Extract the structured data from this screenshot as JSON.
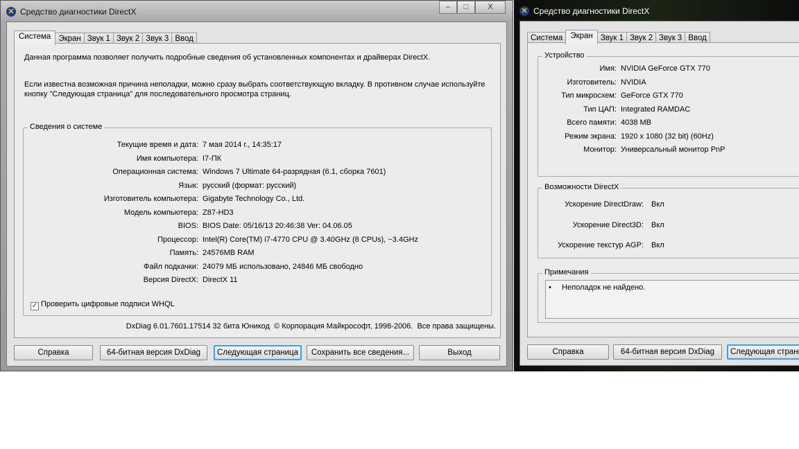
{
  "window_title": "Средство диагностики DirectX",
  "tabs": [
    "Система",
    "Экран",
    "Звук 1",
    "Звук 2",
    "Звук 3",
    "Ввод"
  ],
  "left": {
    "intro1": "Данная программа позволяет получить подробные сведения об установленных компонентах и драйверах DirectX.",
    "intro2": "Если известна возможная причина неполадки, можно сразу выбрать соответствующую вкладку. В противном случае используйте кнопку \"Следующая страница\" для последовательного просмотра страниц.",
    "group_title": "Сведения о системе",
    "rows": [
      {
        "k": "Текущие время и дата:",
        "v": "7 мая 2014 г., 14:35:17"
      },
      {
        "k": "Имя компьютера:",
        "v": "I7-ПК"
      },
      {
        "k": "Операционная система:",
        "v": "Windows 7 Ultimate 64-разрядная (6.1, сборка 7601)"
      },
      {
        "k": "Язык:",
        "v": "русский (формат: русский)"
      },
      {
        "k": "Изготовитель компьютера:",
        "v": "Gigabyte Technology Co., Ltd."
      },
      {
        "k": "Модель компьютера:",
        "v": "Z87-HD3"
      },
      {
        "k": "BIOS:",
        "v": "BIOS Date: 05/16/13 20:46:38 Ver: 04.06.05"
      },
      {
        "k": "Процессор:",
        "v": "Intel(R) Core(TM) i7-4770 CPU @ 3.40GHz (8 CPUs), ~3.4GHz"
      },
      {
        "k": "Память:",
        "v": "24576MB RAM"
      },
      {
        "k": "Файл подкачки:",
        "v": "24079 МБ использовано, 24846 МБ свободно"
      },
      {
        "k": "Версия DirectX:",
        "v": "DirectX 11"
      }
    ],
    "whql_label": "Проверить цифровые подписи WHQL",
    "whql_checked": true,
    "footer": "DxDiag 6.01.7601.17514 32 бита Юникод  © Корпорация Майкрософт, 1998-2006.  Все права защищены."
  },
  "right": {
    "device_title": "Устройство",
    "device_rows": [
      {
        "k": "Имя:",
        "v": "NVIDIA GeForce GTX 770"
      },
      {
        "k": "Изготовитель:",
        "v": "NVIDIA"
      },
      {
        "k": "Тип микросхем:",
        "v": "GeForce GTX 770"
      },
      {
        "k": "Тип ЦАП:",
        "v": "Integrated RAMDAC"
      },
      {
        "k": "Всего памяти:",
        "v": "4038 MB"
      },
      {
        "k": "Режим экрана:",
        "v": "1920 x 1080 (32 bit) (60Hz)"
      },
      {
        "k": "Монитор:",
        "v": "Универсальный монитор PnP"
      }
    ],
    "caps_title": "Возможности DirectX",
    "caps_rows": [
      {
        "k": "Ускорение DirectDraw:",
        "v": "Вкл"
      },
      {
        "k": "Ускорение Direct3D:",
        "v": "Вкл"
      },
      {
        "k": "Ускорение текстур AGP:",
        "v": "Вкл"
      }
    ],
    "notes_title": "Примечания",
    "notes": "Неполадок не найдено."
  },
  "buttons": {
    "help": "Справка",
    "dxdiag64": "64-битная версия DxDiag",
    "next": "Следующая страница",
    "save": "Сохранить все сведения...",
    "exit": "Выход"
  },
  "caption_buttons": {
    "min": "–",
    "max": "□",
    "close": "X"
  }
}
